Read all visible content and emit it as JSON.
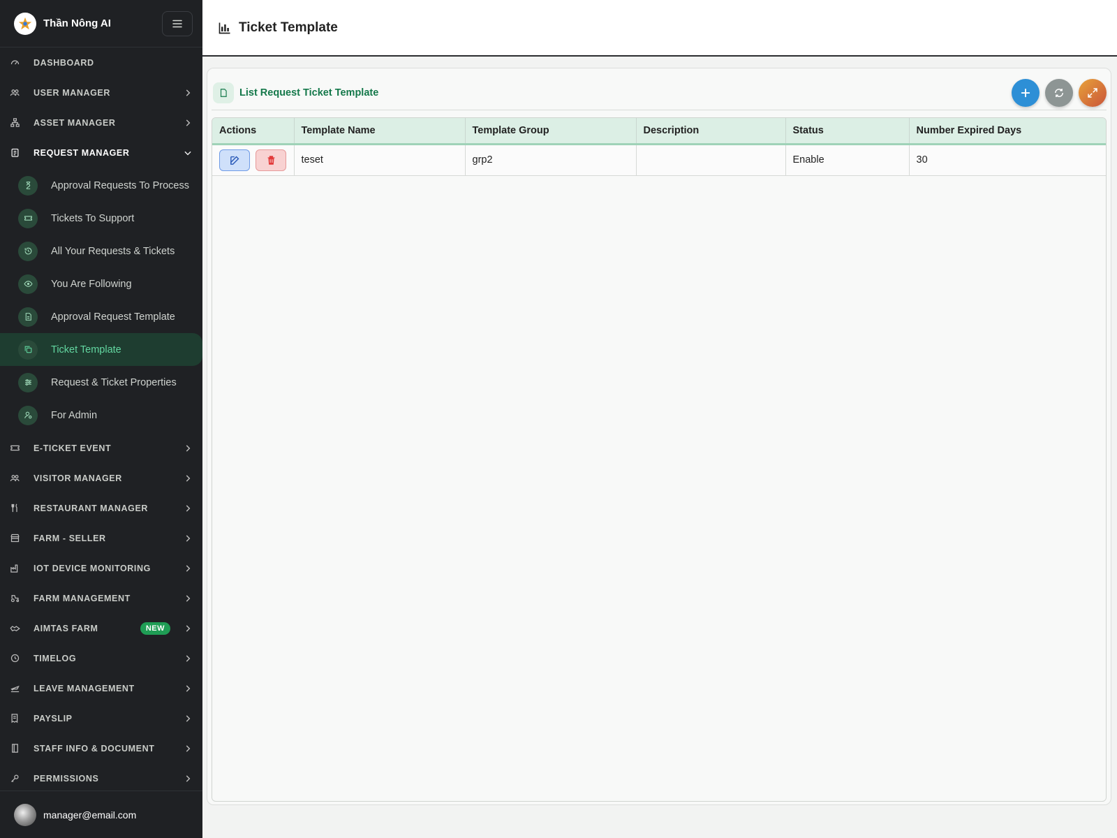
{
  "brand": {
    "name": "Thần Nông AI"
  },
  "sidebar": {
    "top_items": [
      {
        "label": "DASHBOARD",
        "icon": "dashboard-icon",
        "has_chevron": false
      },
      {
        "label": "USER MANAGER",
        "icon": "users-icon",
        "has_chevron": true
      },
      {
        "label": "ASSET MANAGER",
        "icon": "hierarchy-icon",
        "has_chevron": true
      },
      {
        "label": "REQUEST MANAGER",
        "icon": "clipboard-icon",
        "has_chevron": true,
        "expanded": true
      }
    ],
    "request_manager_items": [
      {
        "label": "Approval Requests To Process",
        "icon": "hourglass-icon"
      },
      {
        "label": "Tickets To Support",
        "icon": "ticket-icon"
      },
      {
        "label": "All Your Requests & Tickets",
        "icon": "history-icon"
      },
      {
        "label": "You Are Following",
        "icon": "eye-icon"
      },
      {
        "label": "Approval Request Template",
        "icon": "document-icon"
      },
      {
        "label": "Ticket Template",
        "icon": "copy-icon",
        "active": true
      },
      {
        "label": "Request & Ticket Properties",
        "icon": "sliders-icon"
      },
      {
        "label": "For Admin",
        "icon": "user-gear-icon"
      }
    ],
    "bottom_items": [
      {
        "label": "E-TICKET EVENT",
        "icon": "ticket-icon"
      },
      {
        "label": "VISITOR MANAGER",
        "icon": "visitors-icon"
      },
      {
        "label": "RESTAURANT MANAGER",
        "icon": "utensils-icon"
      },
      {
        "label": "FARM - SELLER",
        "icon": "store-icon"
      },
      {
        "label": "IOT DEVICE MONITORING",
        "icon": "factory-icon"
      },
      {
        "label": "FARM MANAGEMENT",
        "icon": "tractor-icon"
      },
      {
        "label": "AIMTAS FARM",
        "icon": "handshake-icon",
        "badge": "NEW"
      },
      {
        "label": "TIMELOG",
        "icon": "clock-icon"
      },
      {
        "label": "LEAVE MANAGEMENT",
        "icon": "plane-icon"
      },
      {
        "label": "PAYSLIP",
        "icon": "receipt-icon"
      },
      {
        "label": "STAFF INFO & DOCUMENT",
        "icon": "book-icon"
      },
      {
        "label": "PERMISSIONS",
        "icon": "key-icon"
      }
    ],
    "user_email": "manager@email.com"
  },
  "header": {
    "title": "Ticket Template"
  },
  "card": {
    "title": "List Request Ticket Template"
  },
  "table": {
    "columns": [
      "Actions",
      "Template Name",
      "Template Group",
      "Description",
      "Status",
      "Number Expired Days"
    ],
    "rows": [
      {
        "template_name": "teset",
        "template_group": "grp2",
        "description": "",
        "status": "Enable",
        "expired_days": "30"
      }
    ]
  },
  "colors": {
    "sidebar_bg": "#1f2124",
    "accent_green": "#14784a",
    "active_text": "#62d6a0",
    "add_button": "#2d8fd6",
    "badge_new": "#1f9d55"
  }
}
